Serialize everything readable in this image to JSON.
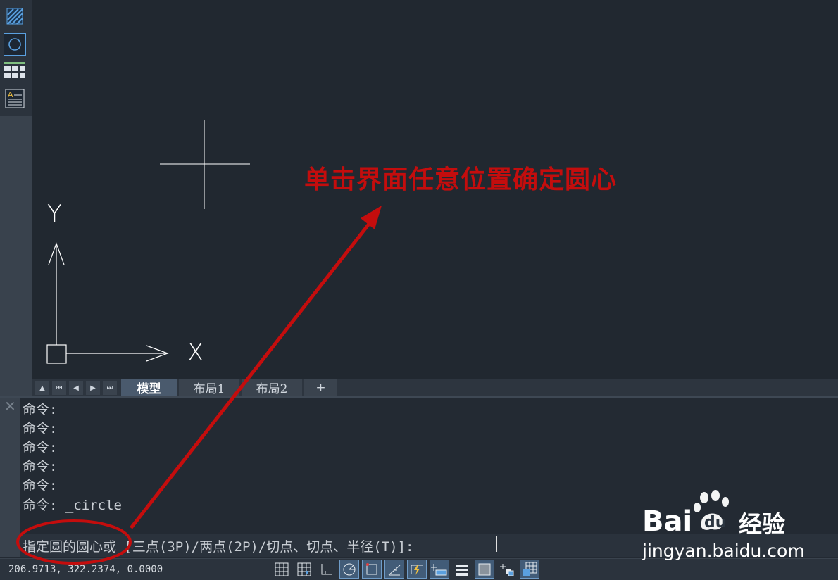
{
  "left_toolbar": {
    "icons": [
      "hatch-icon",
      "circle-icon",
      "table-icon",
      "multiline-text-icon"
    ]
  },
  "canvas": {
    "crosshair": "cursor-crosshair",
    "ucs": {
      "y_label": "Y",
      "x_label": "X"
    }
  },
  "layout_tabs": {
    "nav": [
      "▲",
      "⏮",
      "◀",
      "▶",
      "⏭"
    ],
    "tabs": [
      {
        "label": "模型",
        "active": true
      },
      {
        "label": "布局1",
        "active": false
      },
      {
        "label": "布局2",
        "active": false
      },
      {
        "label": "+",
        "active": false
      }
    ]
  },
  "command": {
    "close": "✕",
    "history": [
      "命令:",
      "命令:",
      "命令:",
      "命令:",
      "命令:",
      "命令: _circle"
    ],
    "prompt": "指定圆的圆心或 [三点(3P)/两点(2P)/切点、切点、半径(T)]:"
  },
  "status_bar": {
    "coordinates": "206.9713, 322.2374, 0.0000",
    "buttons": [
      {
        "icon": "grid-display-icon",
        "on": false
      },
      {
        "icon": "snap-mode-icon",
        "on": false
      },
      {
        "icon": "ortho-mode-icon",
        "on": false
      },
      {
        "icon": "polar-tracking-icon",
        "on": true
      },
      {
        "icon": "object-snap-icon",
        "on": true
      },
      {
        "icon": "object-snap-tracking-icon",
        "on": true
      },
      {
        "icon": "dynamic-input-icon",
        "on": true
      },
      {
        "icon": "dynamic-ucs-icon",
        "on": true
      },
      {
        "icon": "lineweight-icon",
        "on": false
      },
      {
        "icon": "transparency-icon",
        "on": true
      },
      {
        "icon": "selection-cycling-icon",
        "on": false
      },
      {
        "icon": "annotation-monitor-icon",
        "on": true
      }
    ]
  },
  "annotation": {
    "text": "单击界面任意位置确定圆心",
    "color": "#c40d0d"
  },
  "watermark": {
    "brand_left": "Bai",
    "brand_right": "du",
    "product": "经验",
    "url": "jingyan.baidu.com"
  },
  "colors": {
    "canvas_bg": "#212830",
    "annotation_red": "#c40d0d",
    "toggle_on": "#425c78"
  }
}
